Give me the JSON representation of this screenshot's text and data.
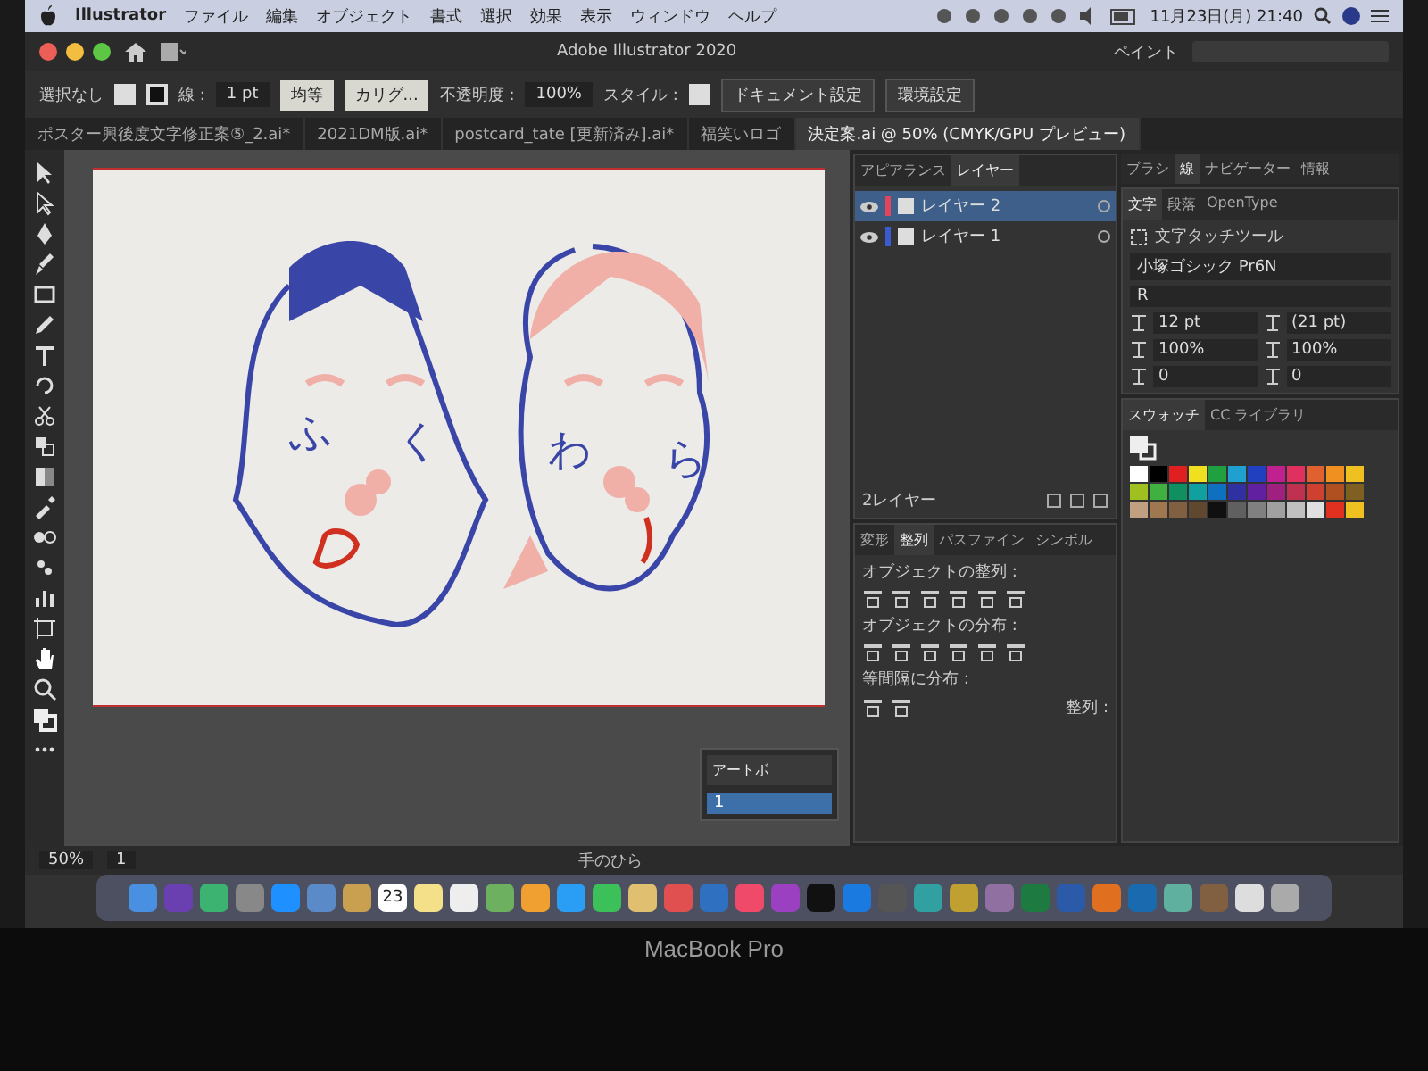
{
  "menu_bar": {
    "app": "Illustrator",
    "items": [
      "ファイル",
      "編集",
      "オブジェクト",
      "書式",
      "選択",
      "効果",
      "表示",
      "ウィンドウ",
      "ヘルプ"
    ],
    "clock": "11月23日(月) 21:40"
  },
  "title_bar": {
    "title": "Adobe Illustrator 2020",
    "workspace": "ペイント"
  },
  "control_bar": {
    "selection": "選択なし",
    "stroke_label": "線 :",
    "stroke_weight": "1 pt",
    "profile": "均等",
    "brush": "カリグ...",
    "opacity_label": "不透明度 :",
    "opacity": "100%",
    "style_label": "スタイル :",
    "buttons": [
      "ドキュメント設定",
      "環境設定"
    ]
  },
  "document_tabs": [
    {
      "label": "ポスター興後度文字修正案⑤_2.ai*",
      "selected": false
    },
    {
      "label": "2021DM版.ai*",
      "selected": false
    },
    {
      "label": "postcard_tate [更新済み].ai*",
      "selected": false
    },
    {
      "label": "福笑いロゴ",
      "selected": false
    },
    {
      "label": "決定案.ai @ 50% (CMYK/GPU プレビュー)",
      "selected": true
    }
  ],
  "artwork": {
    "letters": [
      "ふ",
      "く",
      "わ",
      "ら"
    ]
  },
  "panels": {
    "top_tabs": [
      {
        "label": "ブラシ",
        "selected": false
      },
      {
        "label": "線",
        "selected": true
      },
      {
        "label": "ナビゲーター",
        "selected": false
      },
      {
        "label": "情報",
        "selected": false
      }
    ],
    "layers": {
      "tabs": [
        {
          "label": "アピアランス",
          "selected": false
        },
        {
          "label": "レイヤー",
          "selected": true
        }
      ],
      "rows": [
        {
          "name": "レイヤー 2",
          "color": "#e0455a",
          "selected": true
        },
        {
          "name": "レイヤー 1",
          "color": "#3a5bd0",
          "selected": false
        }
      ],
      "count": "2レイヤー"
    },
    "align": {
      "tabs": [
        {
          "label": "変形",
          "selected": false
        },
        {
          "label": "整列",
          "selected": true
        },
        {
          "label": "パスファイン",
          "selected": false
        },
        {
          "label": "シンボル",
          "selected": false
        }
      ],
      "sections": [
        "オブジェクトの整列 :",
        "オブジェクトの分布 :",
        "等間隔に分布 :"
      ],
      "align_to": "整列 :"
    },
    "artboards": {
      "title": "アートボ",
      "rows": [
        "1"
      ]
    },
    "character": {
      "tabs": [
        {
          "label": "文字",
          "selected": true
        },
        {
          "label": "段落",
          "selected": false
        },
        {
          "label": "OpenType",
          "selected": false
        }
      ],
      "tool": "文字タッチツール",
      "font": "小塚ゴシック Pr6N",
      "style": "R",
      "size": "12 pt",
      "leading": "(21 pt)",
      "vscale": "100%",
      "hscale": "100%",
      "kerning": "0",
      "tracking": "0"
    },
    "swatches": {
      "tabs": [
        {
          "label": "スウォッチ",
          "selected": true
        },
        {
          "label": "CC ライブラリ",
          "selected": false
        }
      ],
      "colors": [
        {
          "color": "#ffffff"
        },
        {
          "color": "#000000"
        },
        {
          "color": "#e02020"
        },
        {
          "color": "#f0e020"
        },
        {
          "color": "#20a040"
        },
        {
          "color": "#20a0d0"
        },
        {
          "color": "#2040c0"
        },
        {
          "color": "#c02090"
        },
        {
          "color": "#e03060"
        },
        {
          "color": "#e06030"
        },
        {
          "color": "#f09020"
        },
        {
          "color": "#f0c020"
        },
        {
          "color": "#a0c020"
        },
        {
          "color": "#40b040"
        },
        {
          "color": "#109060"
        },
        {
          "color": "#10a0a0"
        },
        {
          "color": "#1070c0"
        },
        {
          "color": "#3030a0"
        },
        {
          "color": "#6020a0"
        },
        {
          "color": "#a02080"
        },
        {
          "color": "#c03050"
        },
        {
          "color": "#d04030"
        },
        {
          "color": "#b05020"
        },
        {
          "color": "#806020"
        },
        {
          "color": "#c0a080"
        },
        {
          "color": "#a07850"
        },
        {
          "color": "#806040"
        },
        {
          "color": "#604830"
        },
        {
          "color": "#101010"
        },
        {
          "color": "#606060"
        },
        {
          "color": "#808080"
        },
        {
          "color": "#a0a0a0"
        },
        {
          "color": "#c0c0c0"
        },
        {
          "color": "#e0e0e0"
        },
        {
          "color": "#e03020"
        },
        {
          "color": "#f0c020"
        }
      ]
    }
  },
  "status_bar": {
    "zoom": "50%",
    "artboard": "1",
    "tool": "手のひら"
  },
  "dock": {
    "calendar_day": "23"
  },
  "device_label": "MacBook Pro"
}
